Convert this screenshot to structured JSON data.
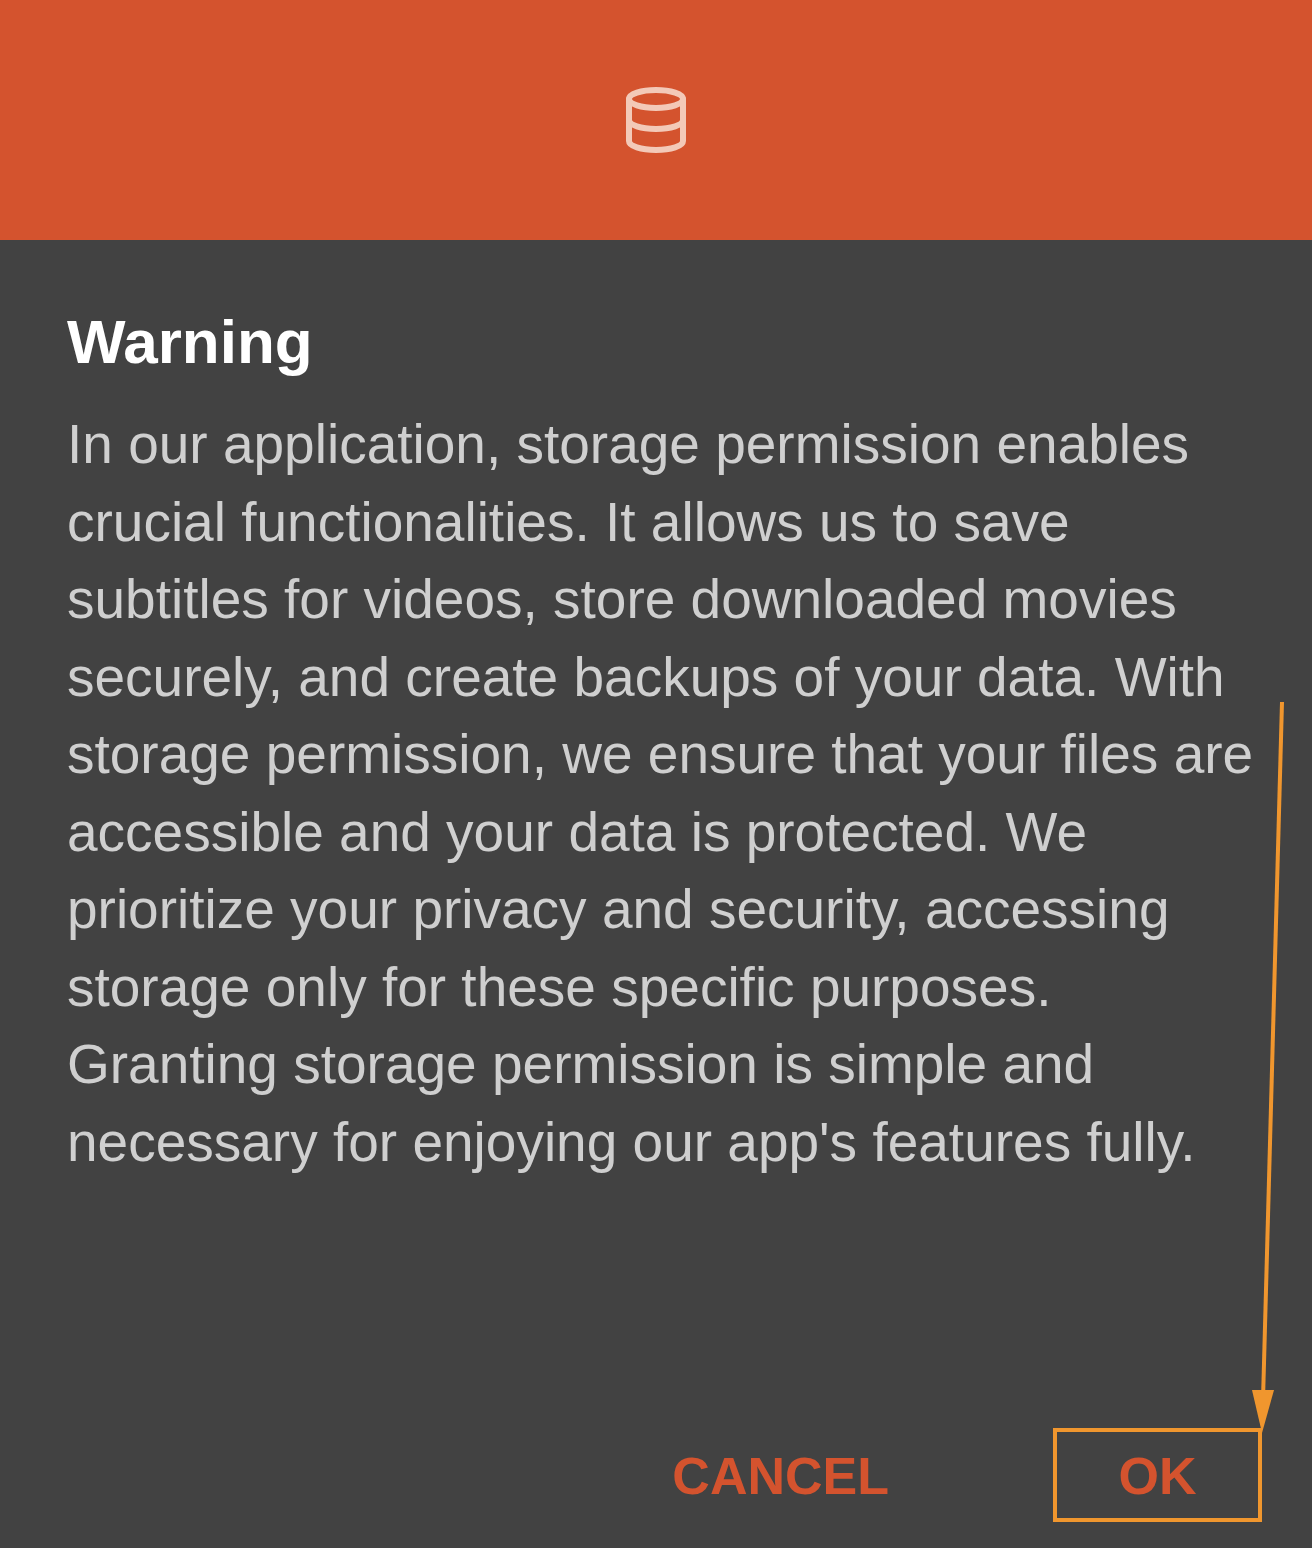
{
  "header": {
    "kind": "storage"
  },
  "dialog": {
    "title": "Warning",
    "message": "In our application, storage permission enables crucial functionalities. It allows us to save subtitles for videos, store downloaded movies securely, and create backups of your data. With storage permission, we ensure that your files are accessible and your data is protected. We prioritize your privacy and security, accessing storage only for these specific purposes. Granting storage permission is simple and necessary for enjoying our app's features fully.",
    "buttons": [
      {
        "label": "CANCEL",
        "highlighted": false
      },
      {
        "label": "OK",
        "highlighted": true
      }
    ]
  }
}
